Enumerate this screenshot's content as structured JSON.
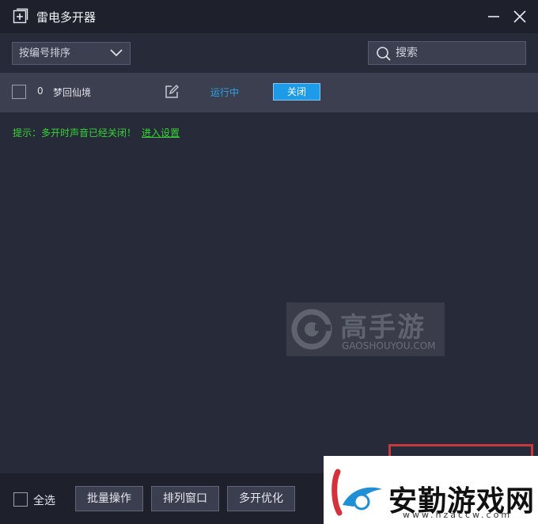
{
  "window": {
    "title": "雷电多开器"
  },
  "toolbar": {
    "sort_selected": "按编号排序",
    "search_placeholder": "搜索"
  },
  "instances": [
    {
      "index": "0",
      "name": "梦回仙境",
      "status": "运行中",
      "action_label": "关闭"
    }
  ],
  "hint": {
    "text": "提示：多开时声音已经关闭！",
    "link": "进入设置"
  },
  "watermark": {
    "title": "高手游",
    "subtitle": "GAOSHOUYOU.COM"
  },
  "footer": {
    "select_all_label": "全选",
    "batch_label": "批量操作",
    "arrange_label": "排列窗口",
    "optimize_label": "多开优化"
  },
  "brand": {
    "title": "安勤游戏网",
    "url": "www.hzaccw.com"
  },
  "colors": {
    "background": "#272a38",
    "titlebar": "#1e212c",
    "row": "#3b3f4f",
    "status_blue": "#2ba3e6",
    "close_button": "#1d9be8",
    "hint_green": "#35d435",
    "red_frame": "#c63a3f"
  },
  "icons": {
    "app": "add-window-icon",
    "minimize": "minimize-icon",
    "close": "close-icon",
    "chevron": "chevron-down-icon",
    "search": "search-icon",
    "edit": "edit-icon"
  }
}
